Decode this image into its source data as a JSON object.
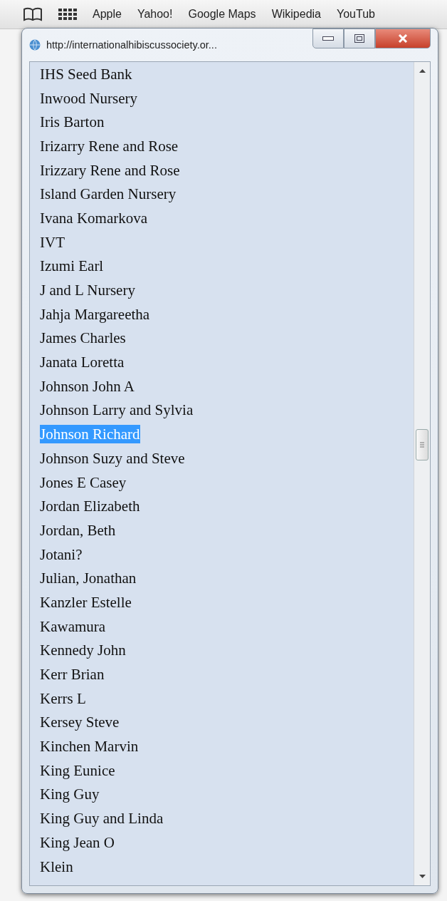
{
  "bookmarks_bar": {
    "items": [
      "Apple",
      "Yahoo!",
      "Google Maps",
      "Wikipedia",
      "YouTub"
    ]
  },
  "popup": {
    "title": "http://internationalhibiscussociety.or...",
    "list": [
      {
        "label": "IHS Seed Bank",
        "selected": false
      },
      {
        "label": "Inwood Nursery",
        "selected": false
      },
      {
        "label": "Iris Barton",
        "selected": false
      },
      {
        "label": "Irizarry Rene and Rose",
        "selected": false
      },
      {
        "label": "Irizzary Rene and Rose",
        "selected": false
      },
      {
        "label": "Island Garden Nursery",
        "selected": false
      },
      {
        "label": "Ivana Komarkova",
        "selected": false
      },
      {
        "label": "IVT",
        "selected": false
      },
      {
        "label": "Izumi Earl",
        "selected": false
      },
      {
        "label": "J and L Nursery",
        "selected": false
      },
      {
        "label": "Jahja Margareetha",
        "selected": false
      },
      {
        "label": "James Charles",
        "selected": false
      },
      {
        "label": "Janata Loretta",
        "selected": false
      },
      {
        "label": "Johnson John A",
        "selected": false
      },
      {
        "label": "Johnson Larry and Sylvia",
        "selected": false
      },
      {
        "label": "Johnson Richard",
        "selected": true
      },
      {
        "label": "Johnson Suzy and Steve",
        "selected": false
      },
      {
        "label": "Jones E Casey",
        "selected": false
      },
      {
        "label": "Jordan Elizabeth",
        "selected": false
      },
      {
        "label": "Jordan, Beth",
        "selected": false
      },
      {
        "label": "Jotani?",
        "selected": false
      },
      {
        "label": "Julian, Jonathan",
        "selected": false
      },
      {
        "label": "Kanzler Estelle",
        "selected": false
      },
      {
        "label": "Kawamura",
        "selected": false
      },
      {
        "label": "Kennedy John",
        "selected": false
      },
      {
        "label": "Kerr Brian",
        "selected": false
      },
      {
        "label": "Kerrs L",
        "selected": false
      },
      {
        "label": "Kersey Steve",
        "selected": false
      },
      {
        "label": "Kinchen Marvin",
        "selected": false
      },
      {
        "label": "King Eunice",
        "selected": false
      },
      {
        "label": "King Guy",
        "selected": false
      },
      {
        "label": "King Guy and Linda",
        "selected": false
      },
      {
        "label": "King Jean O",
        "selected": false
      },
      {
        "label": "Klein",
        "selected": false
      }
    ]
  }
}
